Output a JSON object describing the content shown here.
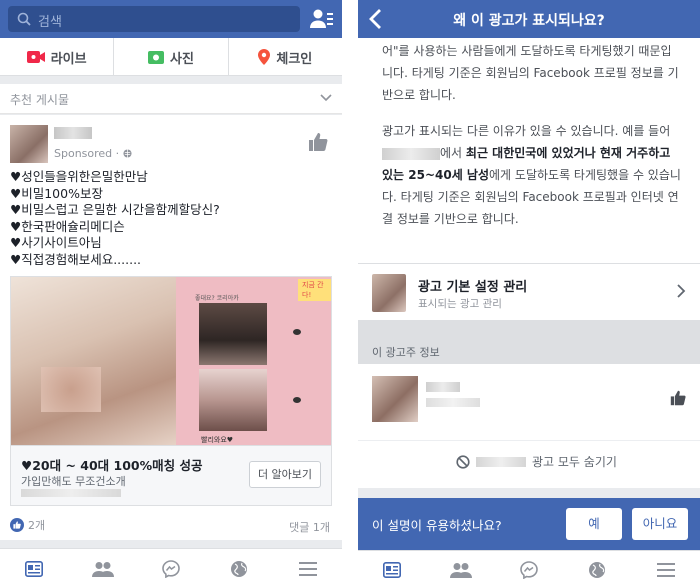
{
  "left": {
    "search_placeholder": "검색",
    "compose": {
      "live": "라이브",
      "photo": "사진",
      "checkin": "체크인"
    },
    "suggested_header": "추천 게시물",
    "post": {
      "sponsored": "Sponsored · ",
      "lines": [
        "♥성인들을위한은밀한만남",
        "♥비밀100%보장",
        "♥비밀스럽고 은밀한 시간을함께할당신?",
        "♥한국판애슐리메디슨",
        "♥사기사이트아님",
        "♥직접경험해보세요......."
      ],
      "ad_badge": "지금 간다!",
      "ad_overlay_top": "좋대요? 코리아카",
      "ad_overlay_bottom": "빨리와요♥",
      "ad_title": "♥20대 ~ 40대 100%매칭 성공",
      "ad_subtitle": "가입만해도 무조건소개",
      "learn_more": "더 알아보기",
      "likes": "2개",
      "comments": "댓글 1개"
    }
  },
  "right": {
    "title": "왜 이 광고가 표시되나요?",
    "para1": "어\"를 사용하는 사람들에게 도달하도록 타게팅했기 때문입니다. 타게팅 기준은 회원님의 Facebook 프로필 정보를 기반으로 합니다.",
    "para2_a": "광고가 표시되는 다른 이유가 있을 수 있습니다. 예를 들어",
    "para2_b": "에서 ",
    "para2_bold1": "최근 대한민국에 있었거나 현재 거주하고 있는 25~40세 남성",
    "para2_c": "에게 도달하도록 타게팅했을 수 있습니다. 타게팅 기준은 회원님의 Facebook 프로필과 인터넷 연결 정보를 기반으로 합니다.",
    "pref_title": "광고 기본 설정 관리",
    "pref_sub": "표시되는 광고 관리",
    "advertiser_header": "이 광고주 정보",
    "hide_all": "광고 모두 숨기기",
    "feedback_q": "이 설명이 유용하셨나요?",
    "yes": "예",
    "no": "아니요"
  },
  "colors": {
    "brand": "#4267b2",
    "live": "#f02849",
    "photo": "#45bd62",
    "checkin": "#f5533d"
  }
}
